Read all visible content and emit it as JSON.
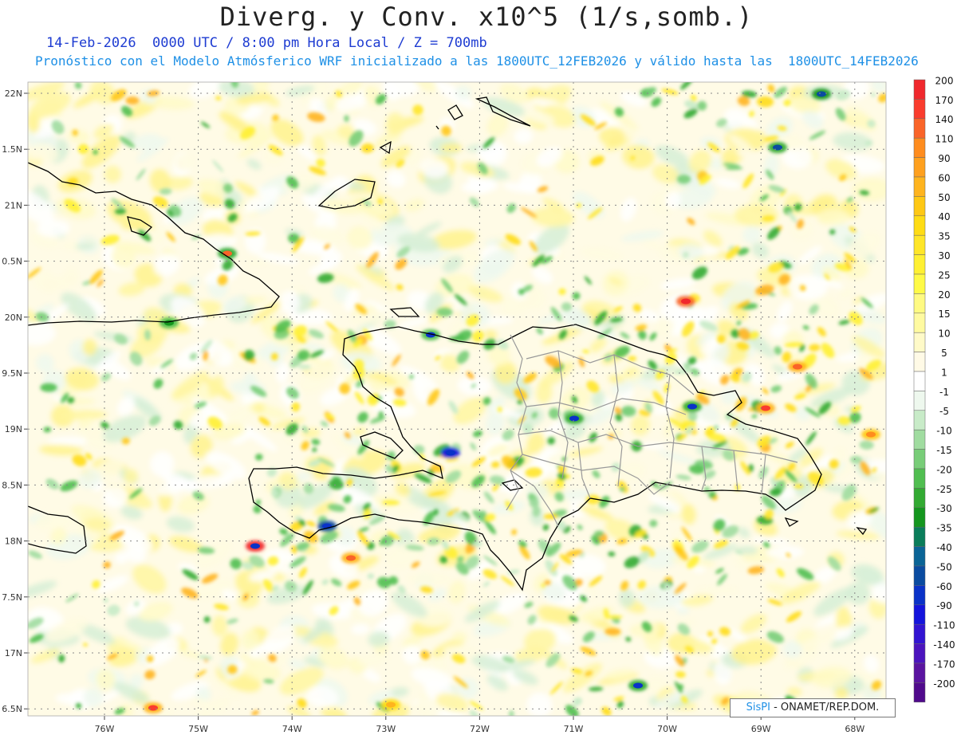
{
  "header": {
    "title": "Diverg. y Conv. x10^5 (1/s,somb.)",
    "line1": "14-Feb-2026  0000 UTC / 8:00 pm Hora Local / Z = 700mb",
    "line2": "Pronóstico con el Modelo Atmósferico WRF inicializado a las 1800UTC_12FEB2026 y válido hasta las  1800UTC_14FEB2026"
  },
  "map": {
    "lat_labels": [
      "22N",
      "1.5N",
      "21N",
      "0.5N",
      "20N",
      "9.5N",
      "19N",
      "8.5N",
      "18N",
      "7.5N",
      "17N",
      "6.5N"
    ],
    "lon_labels": [
      "76W",
      "75W",
      "74W",
      "73W",
      "72W",
      "71W",
      "70W",
      "69W",
      "68W"
    ]
  },
  "colorbar": {
    "labels": [
      "200",
      "170",
      "140",
      "110",
      "90",
      "60",
      "50",
      "40",
      "35",
      "30",
      "25",
      "20",
      "15",
      "10",
      "5",
      "1",
      "-1",
      "-5",
      "-10",
      "-15",
      "-20",
      "-25",
      "-30",
      "-35",
      "-40",
      "-50",
      "-60",
      "-90",
      "-110",
      "-140",
      "-170",
      "-200"
    ],
    "colors": [
      "#f0282d",
      "#fa3c2d",
      "#fa6428",
      "#ff8c1e",
      "#ffa01e",
      "#ffb41e",
      "#ffc814",
      "#ffdc14",
      "#ffe628",
      "#fff032",
      "#fffa46",
      "#fffa82",
      "#fffaa0",
      "#fffac8",
      "#fffae6",
      "#ffffff",
      "#eef8ee",
      "#c8ebc8",
      "#a0dca0",
      "#78cd78",
      "#50be50",
      "#32aa32",
      "#14961e",
      "#0a7d5a",
      "#0a6496",
      "#0a4ba0",
      "#0a32c8",
      "#1414dc",
      "#3214d2",
      "#4b14be",
      "#5a14a0",
      "#500a8c"
    ]
  },
  "credit": {
    "brand": "SisPI",
    "text": "- ONAMET/REP.DOM."
  }
}
